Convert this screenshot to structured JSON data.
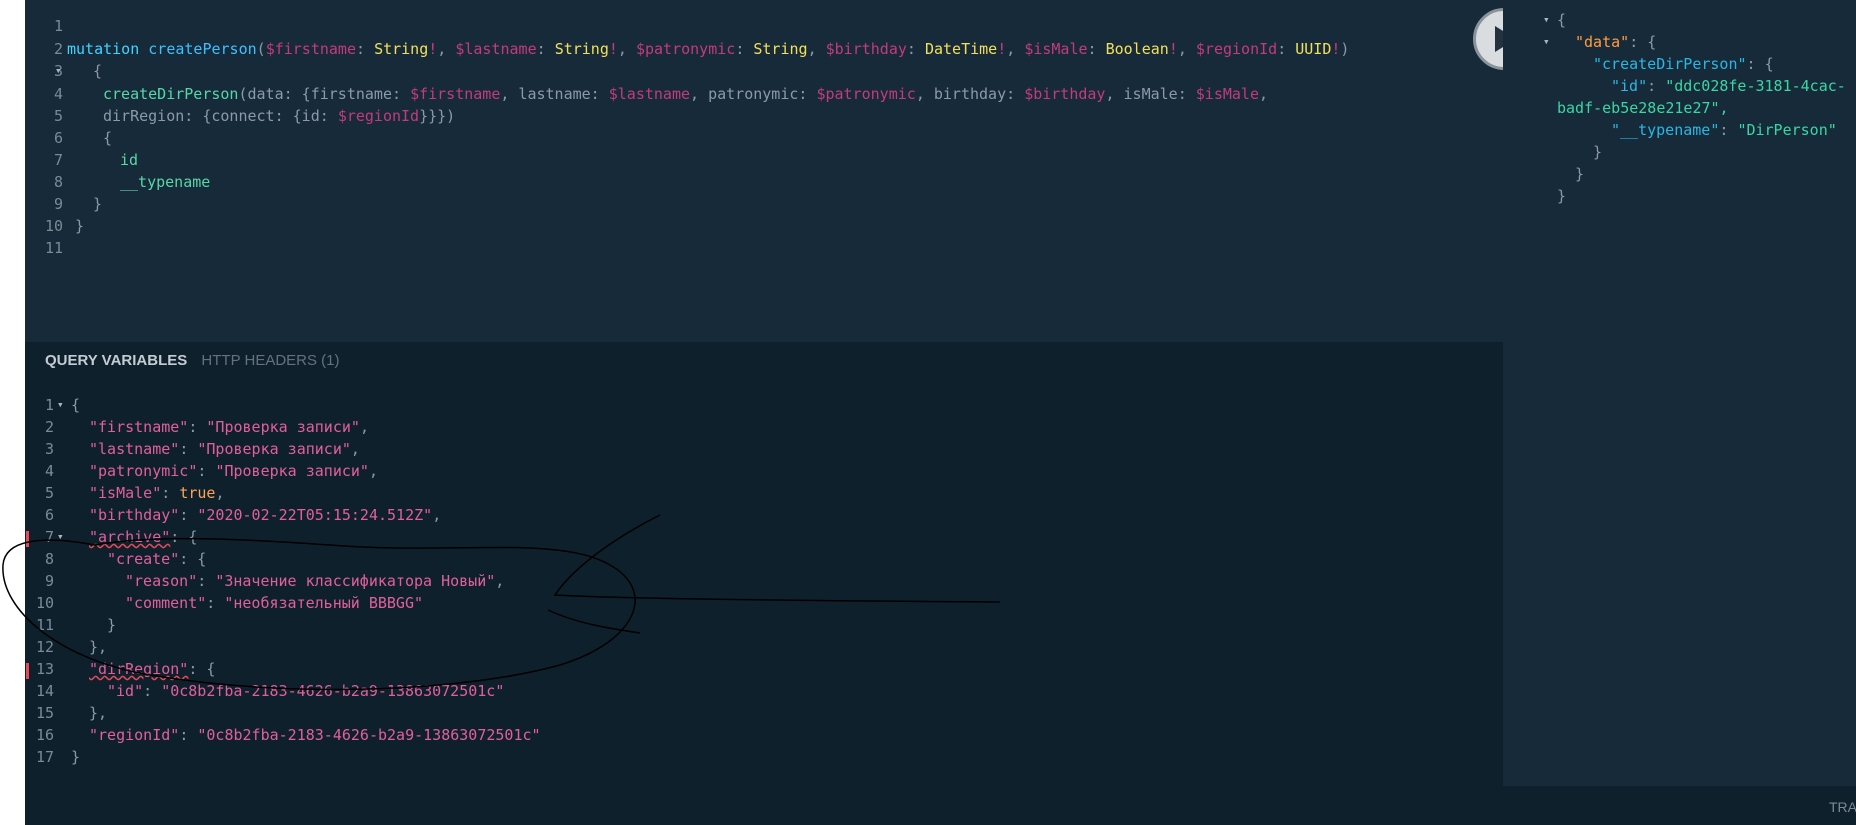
{
  "query_editor": {
    "line_numbers": [
      "1",
      "2",
      "3",
      "4",
      "5",
      "6",
      "7",
      "8",
      "9",
      "10",
      "11"
    ],
    "lines": {
      "l2": {
        "kw": "mutation",
        "name": "createPerson",
        "p1": "(",
        "v1": "$firstname",
        "c1": ": ",
        "t1": "String",
        "b1": "!",
        "s1": ", ",
        "v2": "$lastname",
        "c2": ": ",
        "t2": "String",
        "b2": "!",
        "s2": ", ",
        "v3": "$patronymic",
        "c3": ": ",
        "t3": "String",
        "s3": ", ",
        "v4": "$birthday",
        "c4": ": ",
        "t4": "DateTime",
        "b4": "!",
        "s4": ", ",
        "v5": "$isMale",
        "c5": ": ",
        "t5": "Boolean",
        "b5": "!",
        "s5": ", ",
        "v6": "$regionId",
        "c6": ": ",
        "t6": "UUID",
        "b6": "!",
        "p2": ")"
      },
      "l3": "{",
      "l4": {
        "f": "createDirPerson",
        "a": "(data: {firstname: ",
        "v1": "$firstname",
        "a2": ", lastname: ",
        "v2": "$lastname",
        "a3": ", patronymic: ",
        "v3": "$patronymic",
        "a4": ", birthday: ",
        "v4": "$birthday",
        "a5": ", isMale: ",
        "v5": "$isMale",
        "a6": ","
      },
      "l5": {
        "a": "dirRegion: {connect: {id: ",
        "v": "$regionId",
        "b": "}}})"
      },
      "l6": "{",
      "l7": "id",
      "l8": "__typename",
      "l9": "}",
      "l10": "}"
    }
  },
  "run_button": {
    "label": "Execute query"
  },
  "tabs": {
    "query_variables": "QUERY VARIABLES",
    "http_headers": "HTTP HEADERS (1)"
  },
  "variables_editor": {
    "line_numbers": [
      "1",
      "2",
      "3",
      "4",
      "5",
      "6",
      "7",
      "8",
      "9",
      "10",
      "11",
      "12",
      "13",
      "14",
      "15",
      "16",
      "17"
    ],
    "lines": {
      "l1": "{",
      "l2k": "\"firstname\"",
      "l2v": "\"Проверка записи\"",
      "l3k": "\"lastname\"",
      "l3v": "\"Проверка записи\"",
      "l4k": "\"patronymic\"",
      "l4v": "\"Проверка записи\"",
      "l5k": "\"isMale\"",
      "l5v": "true",
      "l6k": "\"birthday\"",
      "l6v": "\"2020-02-22T05:15:24.512Z\"",
      "l7k": "\"archive\"",
      "l8k": "\"create\"",
      "l9k": "\"reason\"",
      "l9v": "\"Значение классификатора Новый\"",
      "l10k": "\"comment\"",
      "l10v": "\"необязательный BBBGG\"",
      "l11": "}",
      "l12": "},",
      "l13k": "\"dirRegion\"",
      "l14k": "\"id\"",
      "l14v": "\"0c8b2fba-2183-4626-b2a9-13863072501c\"",
      "l15": "},",
      "l16k": "\"regionId\"",
      "l16v": "\"0c8b2fba-2183-4626-b2a9-13863072501c\"",
      "l17": "}"
    }
  },
  "result": {
    "l1": "{",
    "data_key": "\"data\"",
    "create_key": "\"createDirPerson\"",
    "id_key": "\"id\"",
    "id_val_1": "\"ddc028fe-3181-4cac-",
    "id_val_2": "badf-eb5e28e21e27\",",
    "typename_key": "\"__typename\"",
    "typename_val": "\"DirPerson\"",
    "close3": "}",
    "close2": "}",
    "close1": "}"
  },
  "footer": {
    "tracing": "TRA"
  },
  "colors": {
    "editor_bg": "#172a3a",
    "variables_bg": "#0f202d",
    "run_button": "#d9dde0"
  }
}
